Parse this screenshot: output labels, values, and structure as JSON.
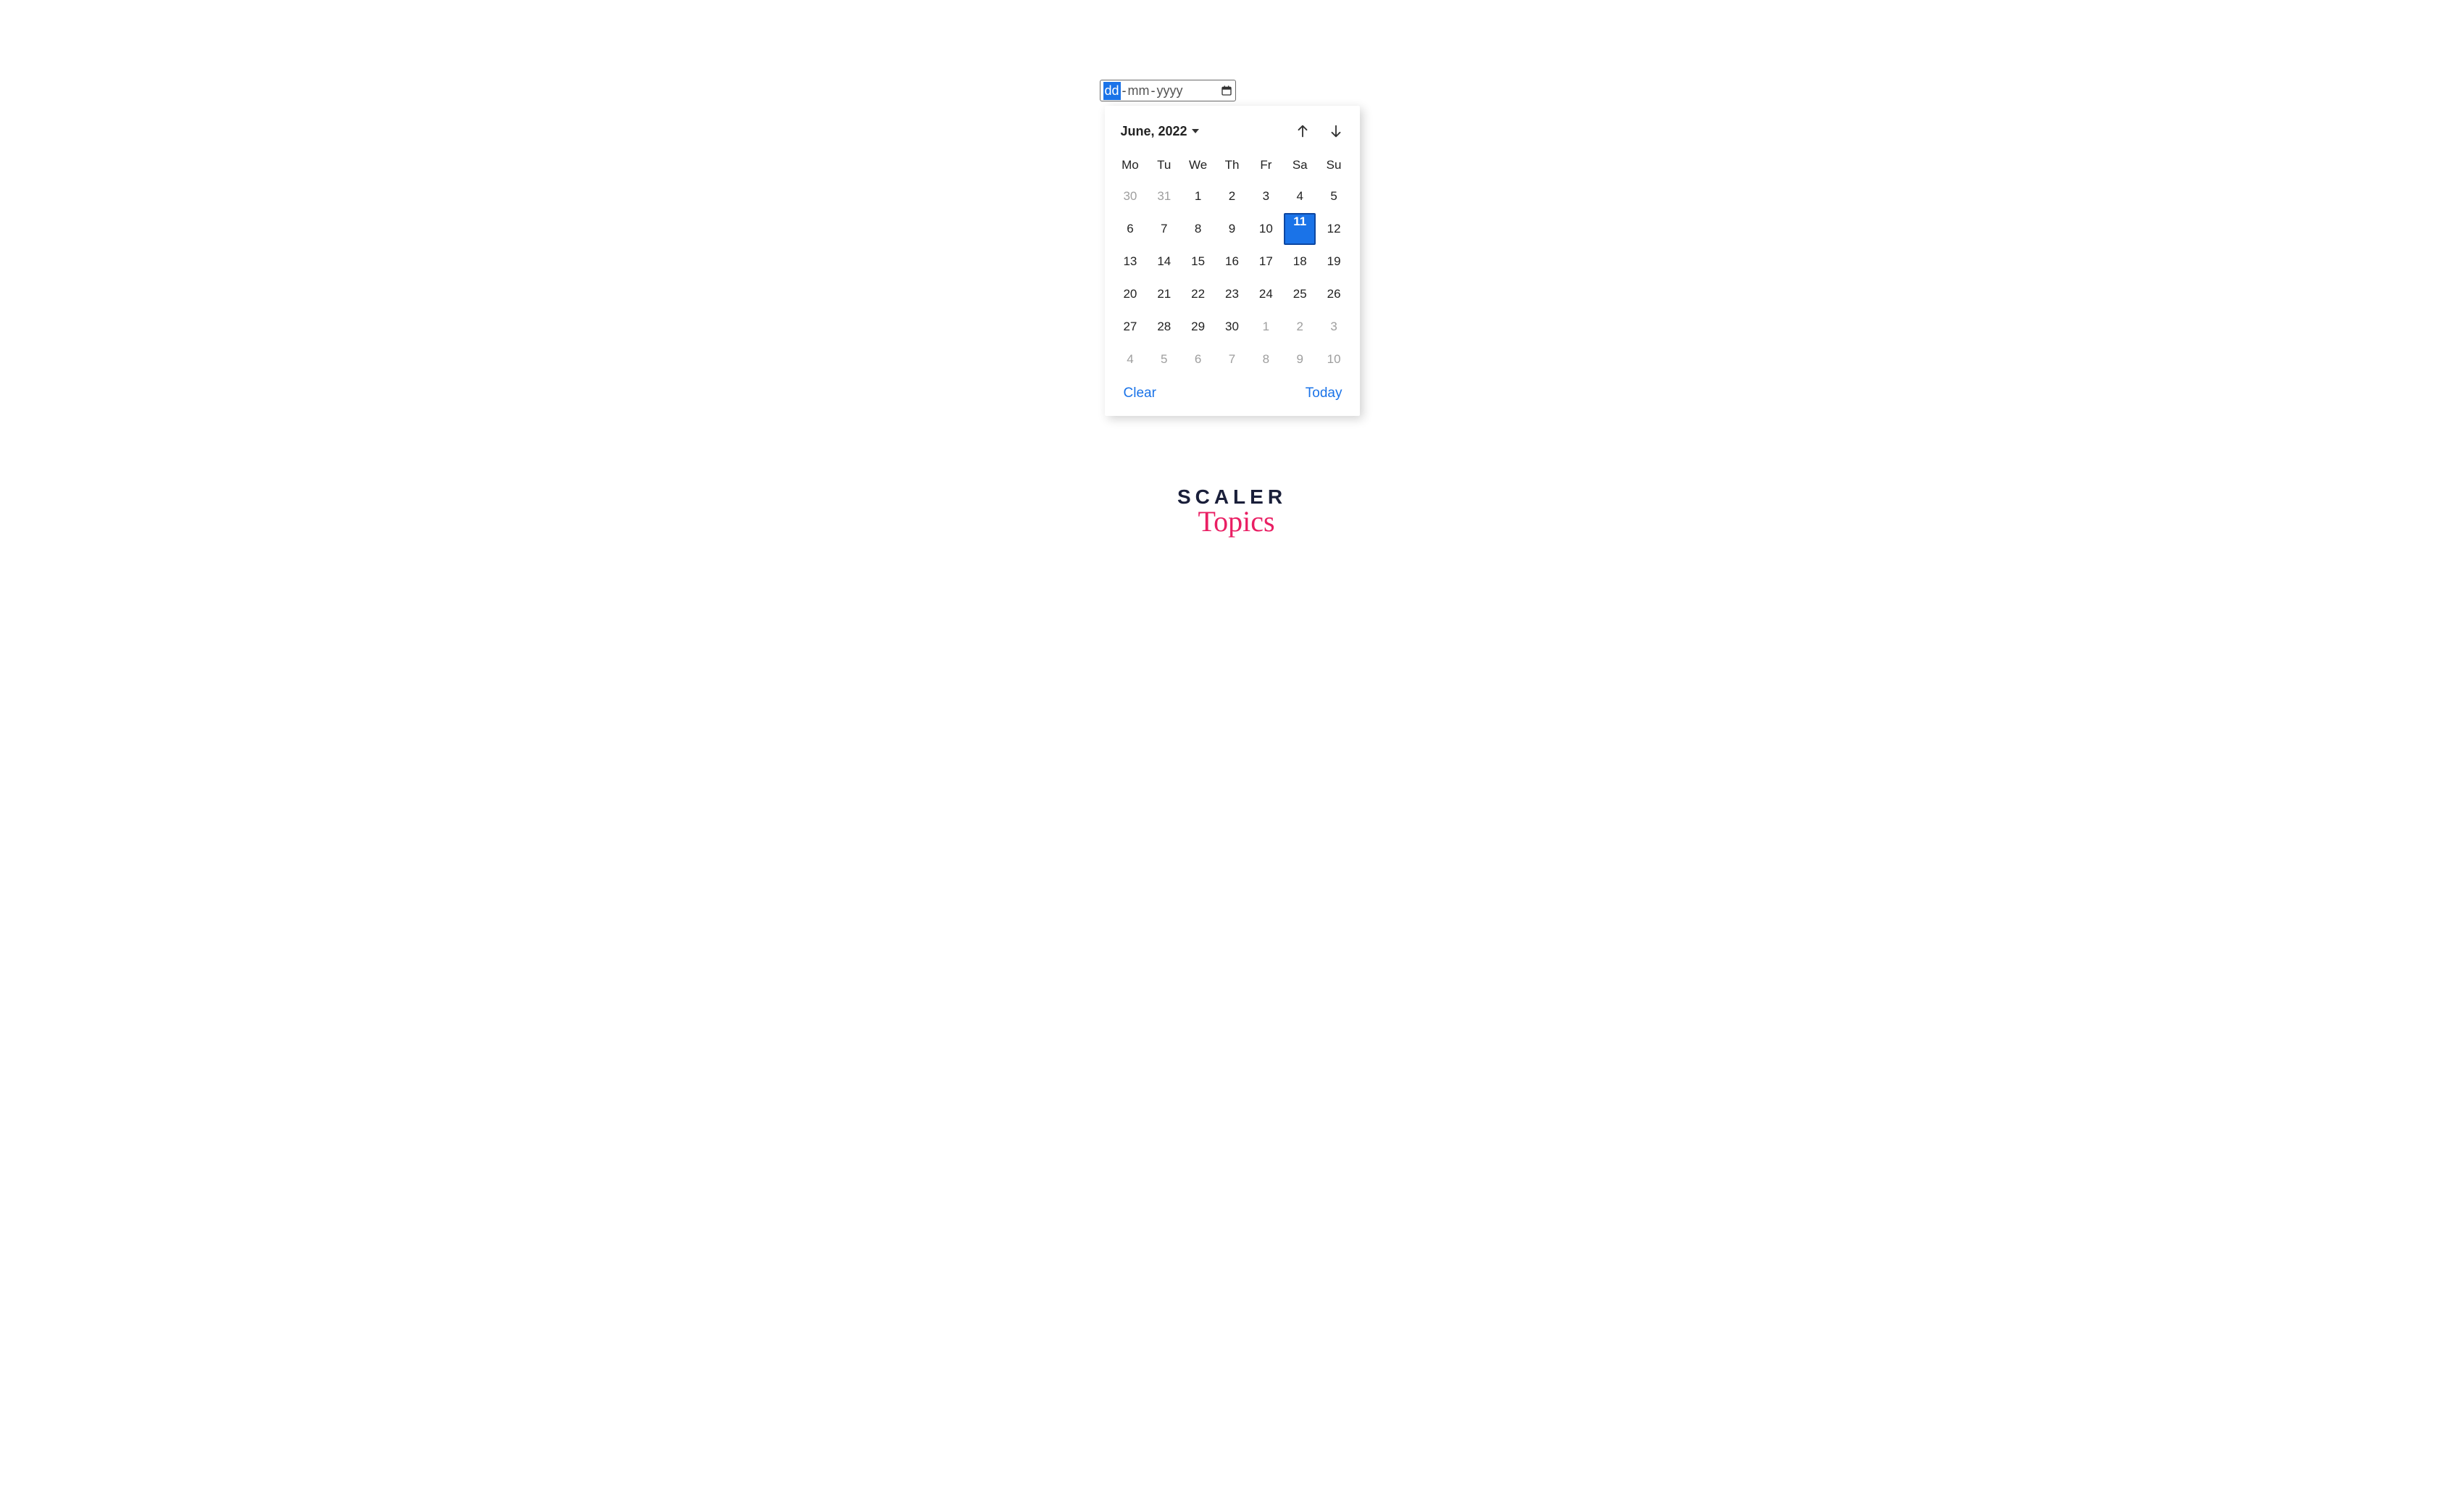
{
  "input": {
    "dd": "dd",
    "mm": "mm",
    "yyyy": "yyyy",
    "sep1": "-",
    "sep2": "-"
  },
  "calendar": {
    "month_label": "June, 2022",
    "dow": [
      "Mo",
      "Tu",
      "We",
      "Th",
      "Fr",
      "Sa",
      "Su"
    ],
    "days": [
      {
        "n": "30",
        "other": true
      },
      {
        "n": "31",
        "other": true
      },
      {
        "n": "1"
      },
      {
        "n": "2"
      },
      {
        "n": "3"
      },
      {
        "n": "4"
      },
      {
        "n": "5"
      },
      {
        "n": "6"
      },
      {
        "n": "7"
      },
      {
        "n": "8"
      },
      {
        "n": "9"
      },
      {
        "n": "10"
      },
      {
        "n": "11",
        "selected": true
      },
      {
        "n": "12"
      },
      {
        "n": "13"
      },
      {
        "n": "14"
      },
      {
        "n": "15"
      },
      {
        "n": "16"
      },
      {
        "n": "17"
      },
      {
        "n": "18"
      },
      {
        "n": "19"
      },
      {
        "n": "20"
      },
      {
        "n": "21"
      },
      {
        "n": "22"
      },
      {
        "n": "23"
      },
      {
        "n": "24"
      },
      {
        "n": "25"
      },
      {
        "n": "26"
      },
      {
        "n": "27"
      },
      {
        "n": "28"
      },
      {
        "n": "29"
      },
      {
        "n": "30"
      },
      {
        "n": "1",
        "other": true
      },
      {
        "n": "2",
        "other": true
      },
      {
        "n": "3",
        "other": true
      },
      {
        "n": "4",
        "other": true
      },
      {
        "n": "5",
        "other": true
      },
      {
        "n": "6",
        "other": true
      },
      {
        "n": "7",
        "other": true
      },
      {
        "n": "8",
        "other": true
      },
      {
        "n": "9",
        "other": true
      },
      {
        "n": "10",
        "other": true
      }
    ],
    "footer": {
      "clear": "Clear",
      "today": "Today"
    }
  },
  "logo": {
    "line1": "SCALER",
    "line2": "Topics"
  }
}
